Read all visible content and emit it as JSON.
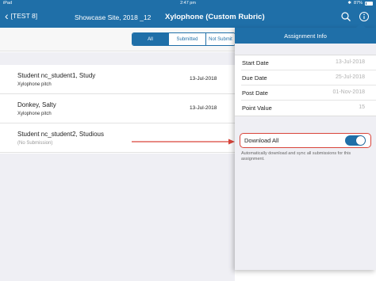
{
  "status_bar": {
    "device": "iPad",
    "time": "2:47 pm",
    "battery": "87%"
  },
  "nav": {
    "back_label": "[TEST     8]",
    "course": "Showcase Site, 2018 _12",
    "title": "Xylophone (Custom Rubric)"
  },
  "tabs": [
    {
      "label": "All",
      "active": true
    },
    {
      "label": "Submitted",
      "active": false
    },
    {
      "label": "Not Submit",
      "active": false
    }
  ],
  "students": [
    {
      "name": "Student nc_student1, Study",
      "subtitle": "Xylophone pitch",
      "date": "13-Jul-2018"
    },
    {
      "name": "Donkey, Salty",
      "subtitle": "Xylophone pitch",
      "date": "13-Jul-2018"
    },
    {
      "name": "Student nc_student2, Studious",
      "subtitle": "(No Submission)",
      "date": ""
    }
  ],
  "assignment_info": {
    "title": "Assignment Info",
    "rows": [
      {
        "label": "Start Date",
        "value": "13-Jul-2018"
      },
      {
        "label": "Due Date",
        "value": "25-Jul-2018"
      },
      {
        "label": "Post Date",
        "value": "01-Nov-2018"
      },
      {
        "label": "Point Value",
        "value": "15"
      }
    ],
    "download_all": {
      "label": "Download All",
      "enabled": true
    },
    "help_text": "Automatically download and sync all submissions for this assignment."
  },
  "colors": {
    "accent": "#1f6fa8",
    "highlight": "#d9443a"
  }
}
